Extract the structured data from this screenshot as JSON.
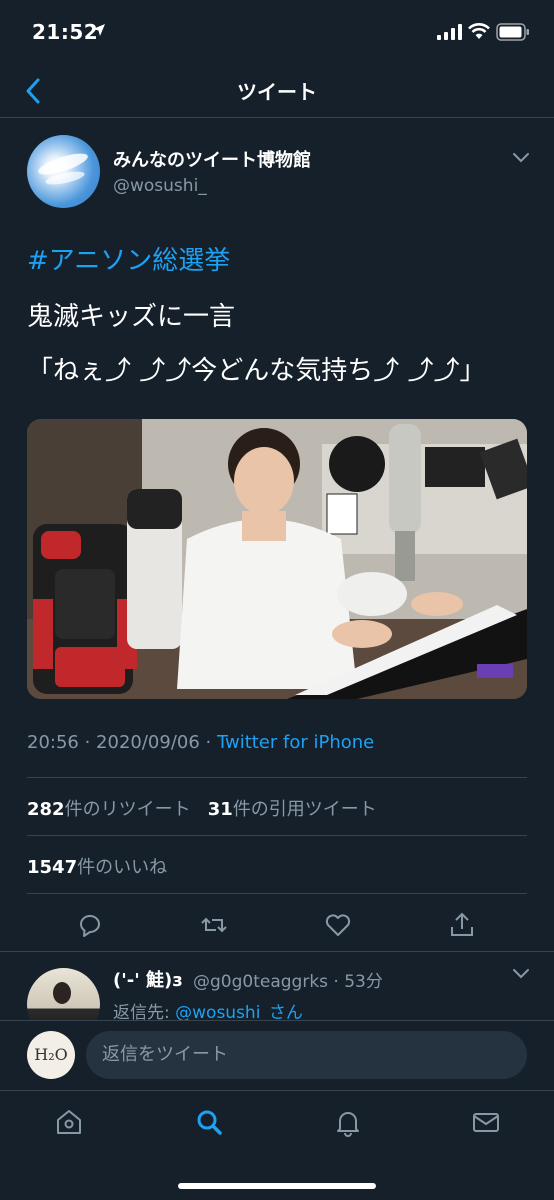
{
  "status_bar": {
    "time": "21:52"
  },
  "nav": {
    "title": "ツイート"
  },
  "author": {
    "name": "みんなのツイート博物館",
    "handle": "@wosushi_"
  },
  "tweet": {
    "hashtag": "#アニソン総選挙",
    "line1": "鬼滅キッズに一言",
    "line2": "「ねぇ⤴︎ ⤴︎⤴︎今どんな気持ち⤴︎ ⤴︎⤴︎」"
  },
  "meta": {
    "datetime": "20:56 · 2020/09/06 · ",
    "source": "Twitter for iPhone"
  },
  "stats": {
    "retweets_count": "282",
    "retweets_label": "件のリツイート",
    "quotes_count": "31",
    "quotes_label": "件の引用ツイート",
    "likes_count": "1547",
    "likes_label": "件のいいね"
  },
  "reply": {
    "name": "('-' 鮭)з",
    "handle_time": "@g0g0teaggrks · 53分",
    "to_prefix": "返信先: ",
    "to_mention": "@wosushi_さん"
  },
  "compose": {
    "avatar_text": "H₂O",
    "placeholder": "返信をツイート"
  },
  "colors": {
    "background": "#15202b",
    "accent": "#1da1f2",
    "secondary_text": "#8899a6",
    "divider": "#38444d"
  }
}
